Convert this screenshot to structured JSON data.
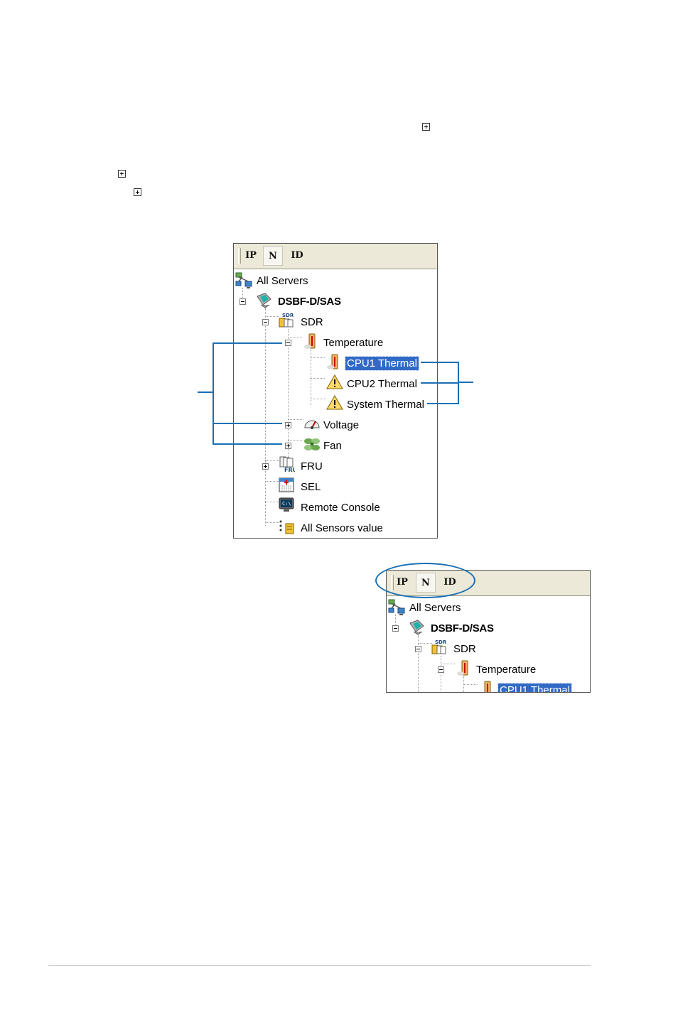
{
  "toolbar": {
    "buttons": [
      "IP",
      "N",
      "ID"
    ],
    "active": "N"
  },
  "tree": {
    "root": "All Servers",
    "server": "DSBF-D/SAS",
    "sdr": "SDR",
    "temperature": "Temperature",
    "cpu1": "CPU1 Thermal",
    "cpu2": "CPU2 Thermal",
    "system": "System Thermal",
    "voltage": "Voltage",
    "fan": "Fan",
    "fru": "FRU",
    "sel": "SEL",
    "console": "Remote Console",
    "sensors": "All Sensors value"
  },
  "icon_labels": {
    "sdr": "SDR",
    "fru": "FRU",
    "console": "C:\\"
  },
  "colors": {
    "callout": "#1a6fb5",
    "selection": "#316ac5",
    "toolbar": "#ece9d8"
  }
}
